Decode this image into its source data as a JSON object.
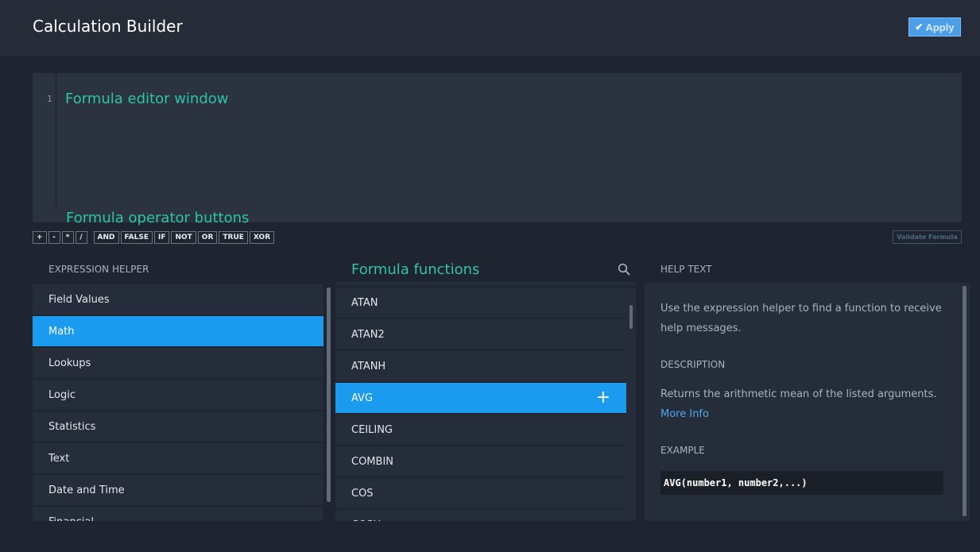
{
  "header": {
    "title": "Calculation Builder",
    "apply_label": "Apply",
    "apply_icon": "check-icon"
  },
  "editor": {
    "line_number": "1",
    "annotation_editor": "Formula editor window",
    "annotation_operators": "Formula operator buttons"
  },
  "operators": {
    "arithmetic": [
      "+",
      "-",
      "*",
      "/"
    ],
    "logical": [
      "AND",
      "FALSE",
      "IF",
      "NOT",
      "OR",
      "TRUE",
      "XOR"
    ]
  },
  "validate_label": "Validate Formula",
  "expression_helper": {
    "label": "EXPRESSION HELPER",
    "items": [
      "Field Values",
      "Math",
      "Lookups",
      "Logic",
      "Statistics",
      "Text",
      "Date and Time",
      "Financial"
    ],
    "selected": "Math"
  },
  "functions": {
    "annotation": "Formula functions",
    "search_icon": "search-icon",
    "items": [
      "ATAN",
      "ATAN2",
      "ATANH",
      "AVG",
      "CEILING",
      "COMBIN",
      "COS",
      "COSH"
    ],
    "selected": "AVG",
    "add_icon": "plus-icon"
  },
  "help": {
    "label": "HELP TEXT",
    "intro": "Use the expression helper to find a function to receive help messages.",
    "description_heading": "DESCRIPTION",
    "description": "Returns the arithmetic mean of the listed arguments.",
    "more_info": "More Info",
    "example_heading": "EXAMPLE",
    "example": "AVG(number1, number2,...)"
  },
  "colors": {
    "accent": "#1a9bf0",
    "annotation": "#2ec4a6",
    "background": "#1e2430"
  }
}
